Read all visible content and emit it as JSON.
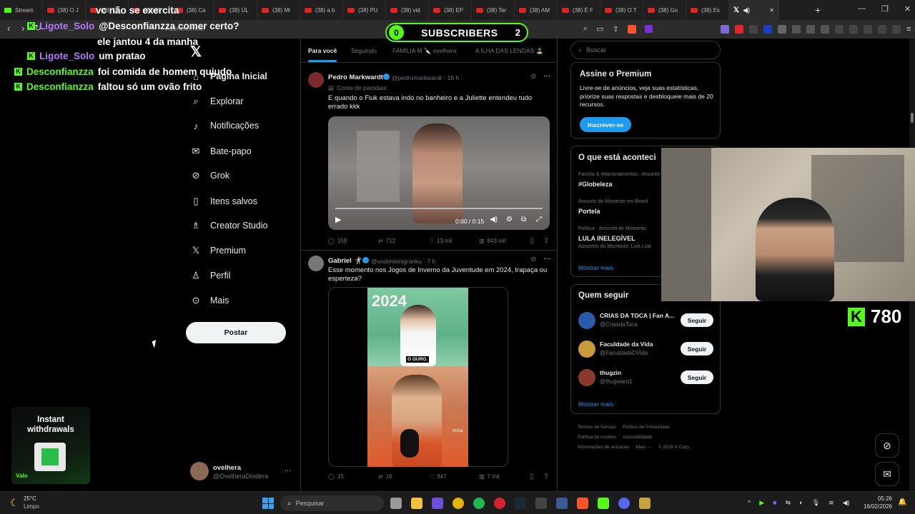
{
  "browser": {
    "tabs": [
      {
        "label": "Stream",
        "type": "kick"
      },
      {
        "label": "(38) O J",
        "type": "yt"
      },
      {
        "label": "(38) Ch",
        "type": "yt"
      },
      {
        "label": "(38) O",
        "type": "yt"
      },
      {
        "label": "(38) Ca",
        "type": "yt"
      },
      {
        "label": "(38) ÚL",
        "type": "yt"
      },
      {
        "label": "(38) Mi",
        "type": "yt"
      },
      {
        "label": "(38) a b",
        "type": "yt"
      },
      {
        "label": "(38) PU",
        "type": "yt"
      },
      {
        "label": "(38) vid",
        "type": "yt"
      },
      {
        "label": "(38) EP",
        "type": "yt"
      },
      {
        "label": "(38) Ter",
        "type": "yt"
      },
      {
        "label": "(38) AM",
        "type": "yt"
      },
      {
        "label": "(38) É F",
        "type": "yt"
      },
      {
        "label": "(38) O T",
        "type": "yt"
      },
      {
        "label": "(38) Go",
        "type": "yt"
      },
      {
        "label": "(38) Es",
        "type": "yt"
      }
    ],
    "active_tab_icon": "x-logo-icon",
    "address_fragment": "Acontecendo"
  },
  "chat": [
    {
      "user": "",
      "msg": "vc não se exercita",
      "color": "nm2"
    },
    {
      "user": "Ligote_Solo",
      "msg": "@Desconfianzza comer certo?",
      "color": "nm1"
    },
    {
      "user": "",
      "msg": "ele jantou 4 da manha",
      "color": "nm1"
    },
    {
      "user": "Ligote_Solo",
      "msg": "um pratao",
      "color": "nm1"
    },
    {
      "user": "Desconfianzza",
      "msg": "foi comida de homem quiudo",
      "color": "nm2"
    },
    {
      "user": "Desconfianzza",
      "msg": "faltou só um ovão frito",
      "color": "nm2"
    }
  ],
  "subs": {
    "left": "0",
    "label": "SUBSCRIBERS",
    "right": "2"
  },
  "kick_count": "780",
  "ad": {
    "line1": "Instant",
    "line2": "withdrawals",
    "foot": "Valo"
  },
  "nav": {
    "items": [
      "Página Inicial",
      "Explorar",
      "Notificações",
      "Bate-papo",
      "Grok",
      "Itens salvos",
      "Creator Studio",
      "Premium",
      "Perfil",
      "Mais"
    ],
    "post_button": "Postar"
  },
  "account": {
    "name": "ovelhera",
    "handle": "@OvelheraDoidera",
    "more": "···"
  },
  "feed_tabs": [
    "Para você",
    "Seguindo",
    "FAMÍLIA M 🔪 ovelhera",
    "A ILHA DAS LENDAS 🏝️"
  ],
  "tweets": [
    {
      "name": "Pedro Markwardt",
      "handle": "@pedromarkwardt · 16 h",
      "label": "Conta de paródias",
      "text": "E quando o Fiuk estava indo no banheiro e a Juliette entendeu tudo errado kkk",
      "video_time": "0:00 / 0:15",
      "replies": "158",
      "reposts": "712",
      "likes": "13 mil",
      "views": "843 mil"
    },
    {
      "name": "Gabriel 🤺",
      "handle": "@vodimtenigranku · 7 h",
      "text": "Esse momento nos Jogos de Inverno da Juventude em 2024, trapaça ou esperteza?",
      "img_top": "2024",
      "img_caption": "O OURO.",
      "img_tag": "TikTok",
      "replies": "15",
      "reposts": "16",
      "likes": "347",
      "views": "7 mil"
    }
  ],
  "search": {
    "placeholder": "Buscar"
  },
  "premium": {
    "title": "Assine o Premium",
    "body": "Livre-se de anúncios, veja suas estatísticas, priorize suas respostas e desbloqueie mais de 20 recursos.",
    "button": "Inscrever-se"
  },
  "trends": {
    "title": "O que está aconteci",
    "items": [
      {
        "context": "Família & relacionamentos · Assunto",
        "name": "#Globeleza"
      },
      {
        "context": "Assunto do Momento em Brasil",
        "name": "Portela"
      },
      {
        "context": "Política · Assunto do Momento",
        "name": "LULA INELEGÍVEL",
        "extra": "Assuntos do Momento: Lula Lula"
      }
    ],
    "more": "Mostrar mais"
  },
  "who": {
    "title": "Quem seguir",
    "items": [
      {
        "name": "CRIAS DA TOCA | Fan A...",
        "handle": "@CriasdaToca",
        "btn": "Seguir"
      },
      {
        "name": "Faculdade da Vida",
        "handle": "@FaculdadeDVida",
        "btn": "Seguir"
      },
      {
        "name": "thugzin",
        "handle": "@thugward1",
        "btn": "Seguir"
      }
    ],
    "more": "Mostrar mais"
  },
  "footer": {
    "links": [
      "Termos de Serviço",
      "Política de Privacidade",
      "Política de cookies",
      "Acessibilidade",
      "Informações de anúncios",
      "Mais ···",
      "© 2026 X Corp."
    ]
  },
  "taskbar": {
    "weather_temp": "25°C",
    "weather_desc": "Limpo",
    "search_placeholder": "Pesquisar",
    "time": "05:26",
    "date": "16/02/2026"
  }
}
